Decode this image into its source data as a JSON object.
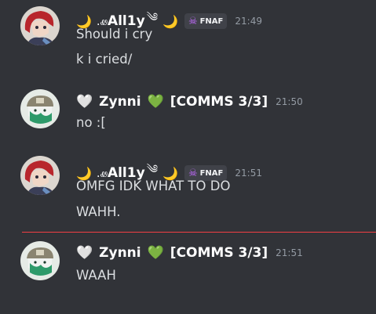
{
  "messages": [
    {
      "author": "All1y",
      "deco_left": ".ꮺ",
      "deco_right": "༄",
      "moon_left": "🌙",
      "moon_right": "🌙",
      "tag": "FNAF",
      "timestamp": "21:49",
      "lines": [
        "Should i cry",
        "k i cried/"
      ]
    },
    {
      "author": "Zynni",
      "heart_left": "🤍",
      "heart_right": "💚",
      "suffix": "[COMMS 3/3]",
      "timestamp": "21:50",
      "lines": [
        "no :["
      ]
    },
    {
      "author": "All1y",
      "deco_left": ".ꮺ",
      "deco_right": "༄",
      "moon_left": "🌙",
      "moon_right": "🌙",
      "tag": "FNAF",
      "timestamp": "21:51",
      "lines": [
        "OMFG IDK WHAT TO DO",
        "WAHH."
      ]
    },
    {
      "author": "Zynni",
      "heart_left": "🤍",
      "heart_right": "💚",
      "suffix": "[COMMS 3/3]",
      "timestamp": "21:51",
      "lines": [
        "WAAH"
      ]
    }
  ],
  "colors": {
    "background": "#313338",
    "new_message_divider": "#f23f43",
    "tag_icon": "#c26bff"
  },
  "icons": {
    "tag_icon": "skull-icon"
  }
}
